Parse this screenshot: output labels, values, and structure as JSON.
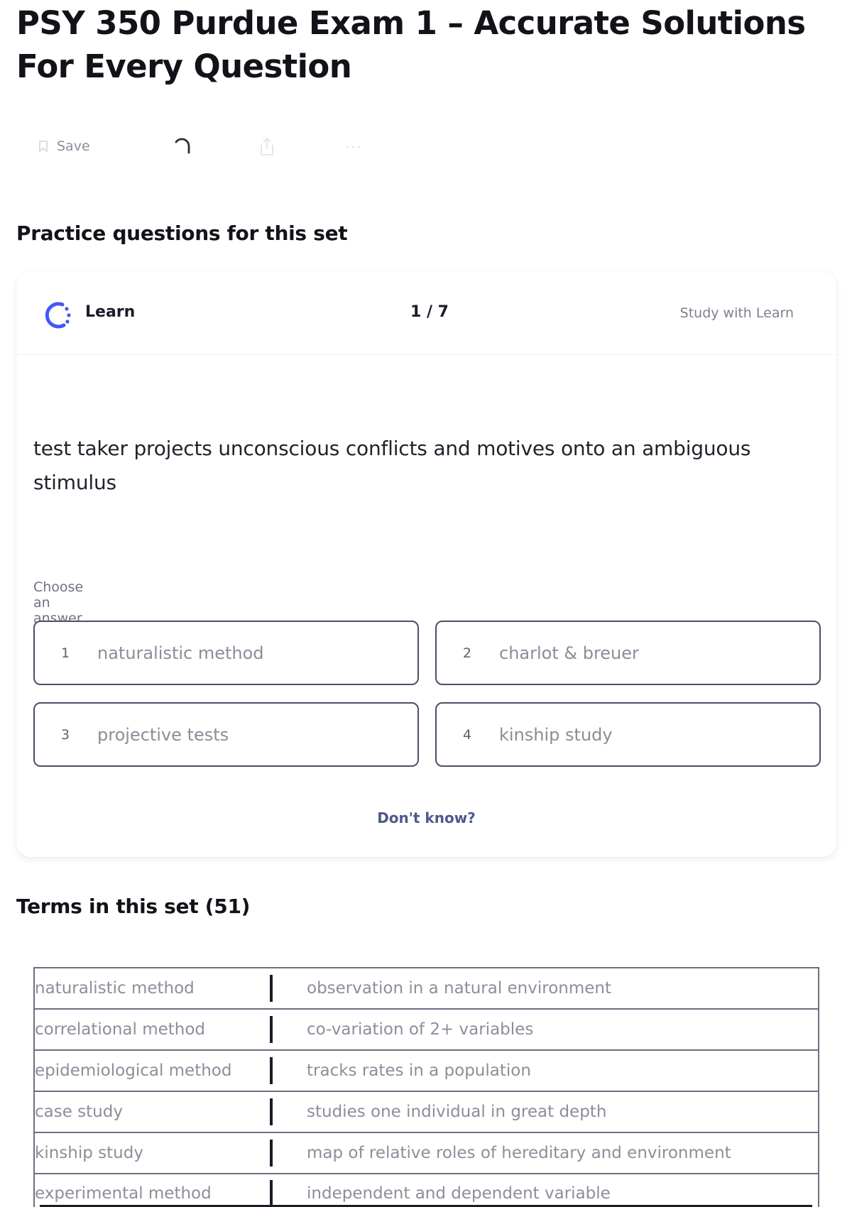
{
  "page": {
    "title": "PSY 350 Purdue Exam 1 – Accurate Solutions For Every Question"
  },
  "toolbar": {
    "save_label": "Save",
    "icons": [
      "bookmark-icon",
      "loading-spinner-icon",
      "share-icon",
      "more-icon"
    ]
  },
  "practice": {
    "heading": "Practice questions for this set",
    "learn_label": "Learn",
    "progress": "1 / 7",
    "study_link": "Study with Learn",
    "question": "test taker projects unconscious conflicts and motives onto an ambiguous stimulus",
    "choose_label": "Choose an answer",
    "answers": [
      {
        "num": "1",
        "text": "naturalistic method"
      },
      {
        "num": "2",
        "text": "charlot & breuer"
      },
      {
        "num": "3",
        "text": "projective tests"
      },
      {
        "num": "4",
        "text": "kinship study"
      }
    ],
    "dont_know": "Don't know?"
  },
  "terms": {
    "heading": "Terms in this set (51)",
    "rows": [
      {
        "term": "naturalistic method",
        "definition": "observation in a natural environment"
      },
      {
        "term": "correlational method",
        "definition": "co-variation of 2+ variables"
      },
      {
        "term": "epidemiological method",
        "definition": "tracks rates in a population"
      },
      {
        "term": "case study",
        "definition": "studies one individual in great depth"
      },
      {
        "term": "kinship study",
        "definition": "map of relative roles of hereditary and environment"
      },
      {
        "term": "experimental method",
        "definition": "independent and dependent variable"
      }
    ]
  },
  "colors": {
    "learn_logo": "#4257f5",
    "answer_border": "#4a5063",
    "dont_know": "#4c5a8a"
  }
}
